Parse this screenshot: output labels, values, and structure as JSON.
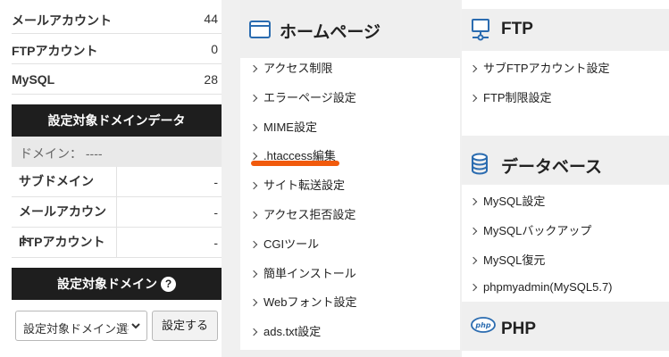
{
  "stats": [
    {
      "label": "メールアカウント",
      "value": "44"
    },
    {
      "label": "FTPアカウント",
      "value": "0"
    },
    {
      "label": "MySQL",
      "value": "28"
    }
  ],
  "domain_data": {
    "header": "設定対象ドメインデータ",
    "domain_label": "ドメイン： ----",
    "rows": [
      {
        "label": "サブドメイン",
        "value": "-"
      },
      {
        "label": "メールアカウント",
        "value": "-"
      },
      {
        "label": "FTPアカウント",
        "value": "-"
      }
    ]
  },
  "domain_select": {
    "header": "設定対象ドメイン",
    "help": "?",
    "selected": "設定対象ドメイン選択",
    "button": "設定する"
  },
  "homepage": {
    "title": "ホームページ",
    "items": [
      "アクセス制限",
      "エラーページ設定",
      "MIME設定",
      ".htaccess編集",
      "サイト転送設定",
      "アクセス拒否設定",
      "CGIツール",
      "簡単インストール",
      "Webフォント設定",
      "ads.txt設定"
    ]
  },
  "ftp": {
    "title": "FTP",
    "items": [
      "サブFTPアカウント設定",
      "FTP制限設定"
    ]
  },
  "database": {
    "title": "データベース",
    "items": [
      "MySQL設定",
      "MySQLバックアップ",
      "MySQL復元",
      "phpmyadmin(MySQL5.7)"
    ]
  },
  "php": {
    "title": "PHP",
    "logo": "php"
  },
  "colors": {
    "accent_underline": "#f15a0c",
    "dark_header": "#1e1e1e",
    "icon_blue": "#2b6cb0"
  }
}
